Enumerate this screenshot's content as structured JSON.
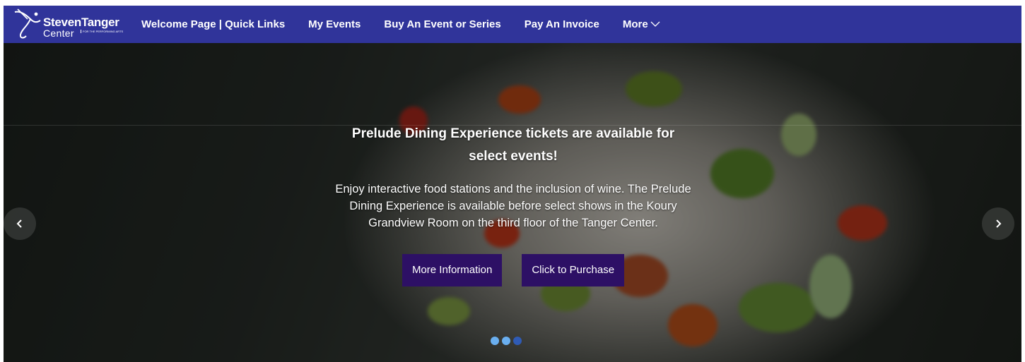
{
  "header": {
    "logo": {
      "name": "StevenTanger",
      "sub": "Center",
      "tagline": "FOR THE PERFORMING ARTS"
    },
    "nav": [
      {
        "label": "Welcome Page | Quick Links"
      },
      {
        "label": "My Events"
      },
      {
        "label": "Buy An Event or Series"
      },
      {
        "label": "Pay An Invoice"
      },
      {
        "label": "More",
        "icon": "chevron-down-icon"
      }
    ]
  },
  "hero": {
    "title": "Prelude Dining Experience tickets are available for select events!",
    "description": "Enjoy interactive food stations and the inclusion of wine. The Prelude Dining Experience is available before select shows in the Koury Grandview Room on the third floor of the Tanger Center.",
    "buttons": {
      "more_info": "More Information",
      "purchase": "Click to Purchase"
    },
    "prev_icon": "chevron-left-icon",
    "next_icon": "chevron-right-icon",
    "slides": {
      "count": 3,
      "active": 1
    }
  },
  "colors": {
    "nav_bg": "#30349a",
    "button_bg": "#2d1065",
    "dot_active": "#6aaff0",
    "dot_inactive": "#2f5bb5"
  }
}
